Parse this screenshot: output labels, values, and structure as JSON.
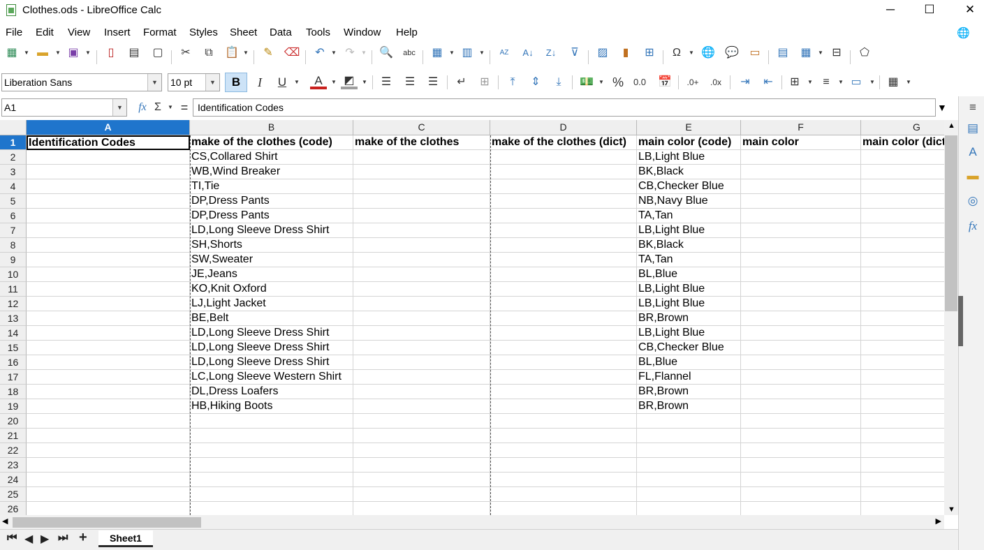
{
  "window": {
    "title": "Clothes.ods - LibreOffice Calc",
    "minimize": "─",
    "maximize": "☐",
    "close": "✕"
  },
  "menu": [
    "File",
    "Edit",
    "View",
    "Insert",
    "Format",
    "Styles",
    "Sheet",
    "Data",
    "Tools",
    "Window",
    "Help"
  ],
  "formatting": {
    "font_name": "Liberation Sans",
    "font_size": "10 pt",
    "bold": "B",
    "italic": "I",
    "underline": "U",
    "percent": "%",
    "number": "0.0"
  },
  "formula_bar": {
    "name_box": "A1",
    "fx": "fx",
    "sum": "Σ",
    "equals": "=",
    "content": "Identification Codes"
  },
  "columns": [
    "A",
    "B",
    "C",
    "D",
    "E",
    "F",
    "G"
  ],
  "rows": [
    "1",
    "2",
    "3",
    "4",
    "5",
    "6",
    "7",
    "8",
    "9",
    "10",
    "11",
    "12",
    "13",
    "14",
    "15",
    "16",
    "17",
    "18",
    "19",
    "20",
    "21",
    "22",
    "23",
    "24",
    "25",
    "26"
  ],
  "cells": {
    "A1": "Identification Codes",
    "B1": "make of the clothes (code)",
    "C1": "make of the clothes",
    "D1": "make of the clothes (dict)",
    "E1": "main color (code)",
    "F1": "main color",
    "G1": "main color (dict)",
    "B": [
      "CS,Collared Shirt",
      "WB,Wind Breaker",
      "TI,Tie",
      "DP,Dress Pants",
      "DP,Dress Pants",
      "LD,Long Sleeve Dress Shirt",
      "SH,Shorts",
      "SW,Sweater",
      "JE,Jeans",
      "KO,Knit Oxford",
      "LJ,Light Jacket",
      "BE,Belt",
      "LD,Long Sleeve Dress Shirt",
      "LD,Long Sleeve Dress Shirt",
      "LD,Long Sleeve Dress Shirt",
      "LC,Long Sleeve Western Shirt",
      "DL,Dress Loafers",
      "HB,Hiking Boots"
    ],
    "E": [
      "LB,Light Blue",
      "BK,Black",
      "CB,Checker Blue",
      "NB,Navy Blue",
      "TA,Tan",
      "LB,Light Blue",
      "BK,Black",
      "TA,Tan",
      "BL,Blue",
      "LB,Light Blue",
      "LB,Light Blue",
      "BR,Brown",
      "LB,Light Blue",
      "CB,Checker Blue",
      "BL,Blue",
      "FL,Flannel",
      "BR,Brown",
      "BR,Brown"
    ]
  },
  "sheets": [
    "Sheet1"
  ],
  "colors": {
    "selection": "#1f75cc",
    "bold_active": "#cde3f7"
  }
}
